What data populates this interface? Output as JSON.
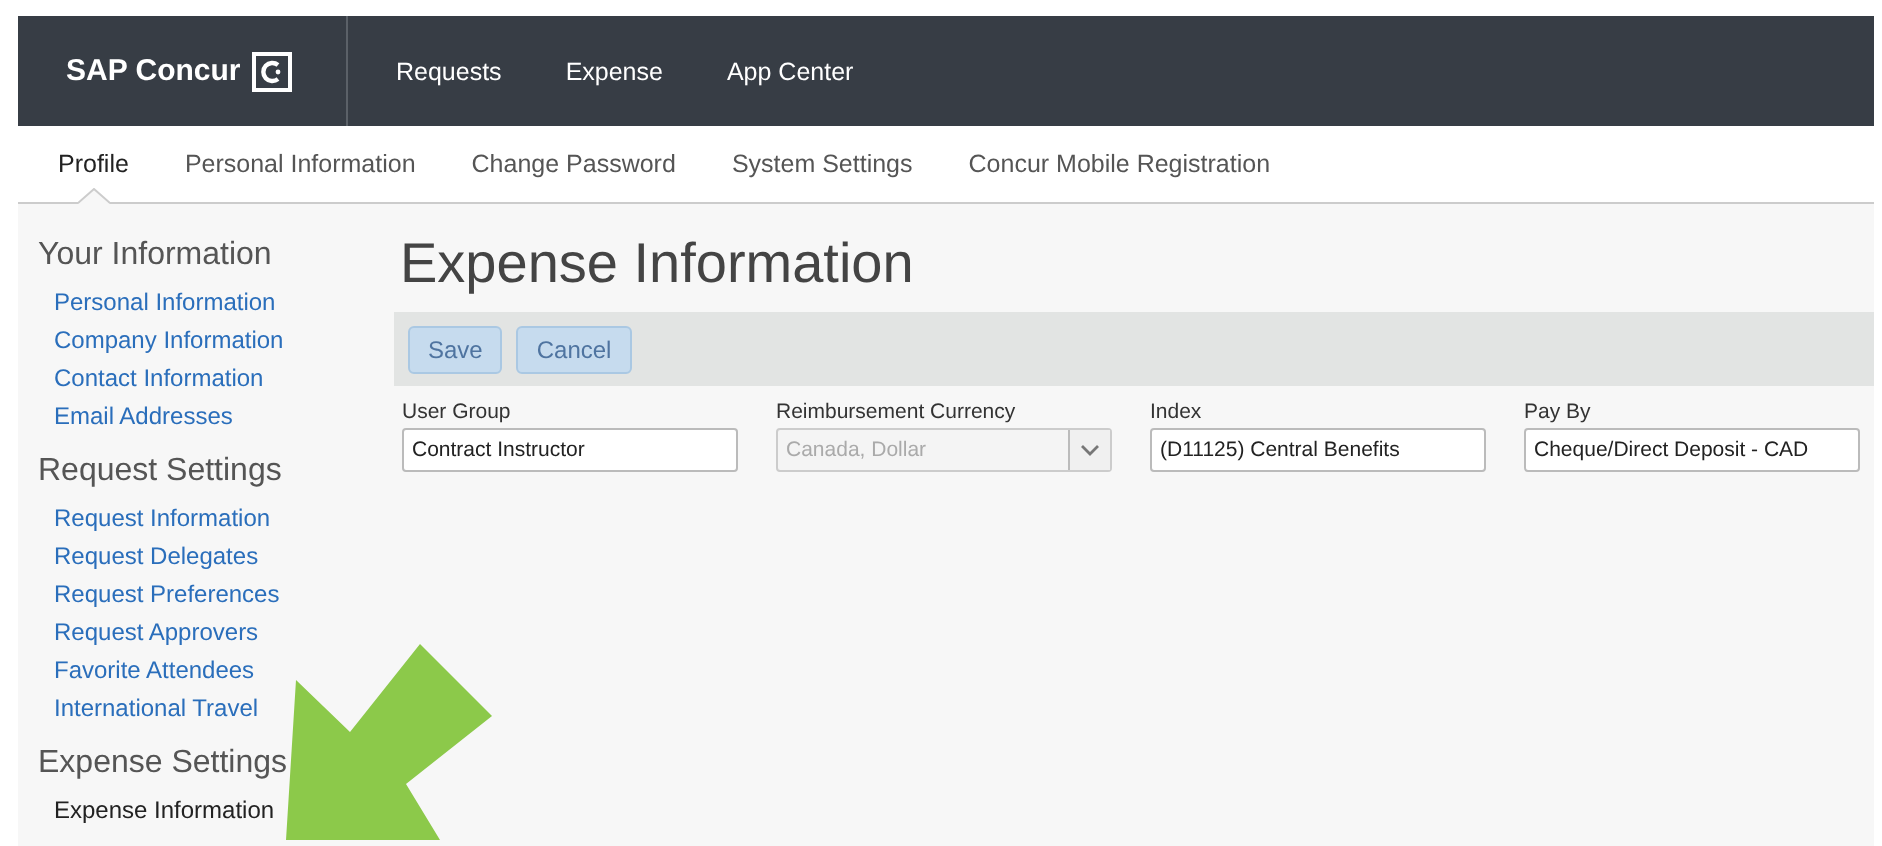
{
  "brand": {
    "name": "SAP Concur"
  },
  "top_nav": [
    {
      "label": "Requests"
    },
    {
      "label": "Expense"
    },
    {
      "label": "App Center"
    }
  ],
  "tabs": [
    {
      "label": "Profile",
      "selected": true
    },
    {
      "label": "Personal Information",
      "selected": false
    },
    {
      "label": "Change Password",
      "selected": false
    },
    {
      "label": "System Settings",
      "selected": false
    },
    {
      "label": "Concur Mobile Registration",
      "selected": false
    }
  ],
  "sidebar": [
    {
      "heading": "Your Information",
      "items": [
        {
          "label": "Personal Information",
          "selected": false
        },
        {
          "label": "Company Information",
          "selected": false
        },
        {
          "label": "Contact Information",
          "selected": false
        },
        {
          "label": "Email Addresses",
          "selected": false
        }
      ]
    },
    {
      "heading": "Request Settings",
      "items": [
        {
          "label": "Request Information",
          "selected": false
        },
        {
          "label": "Request Delegates",
          "selected": false
        },
        {
          "label": "Request Preferences",
          "selected": false
        },
        {
          "label": "Request Approvers",
          "selected": false
        },
        {
          "label": "Favorite Attendees",
          "selected": false
        },
        {
          "label": "International Travel",
          "selected": false
        }
      ]
    },
    {
      "heading": "Expense Settings",
      "items": [
        {
          "label": "Expense Information",
          "selected": true
        }
      ]
    }
  ],
  "page_title": "Expense Information",
  "buttons": [
    {
      "label": "Save",
      "disabled": true
    },
    {
      "label": "Cancel",
      "disabled": true
    }
  ],
  "fields": [
    {
      "kind": "text",
      "label": "User Group",
      "value": "Contract Instructor",
      "disabled": false
    },
    {
      "kind": "select",
      "label": "Reimbursement Currency",
      "value": "Canada, Dollar",
      "disabled": true
    },
    {
      "kind": "text",
      "label": "Index",
      "value": "(D11125) Central Benefits",
      "disabled": false
    },
    {
      "kind": "text",
      "label": "Pay By",
      "value": "Cheque/Direct Deposit - CAD",
      "disabled": false
    }
  ]
}
